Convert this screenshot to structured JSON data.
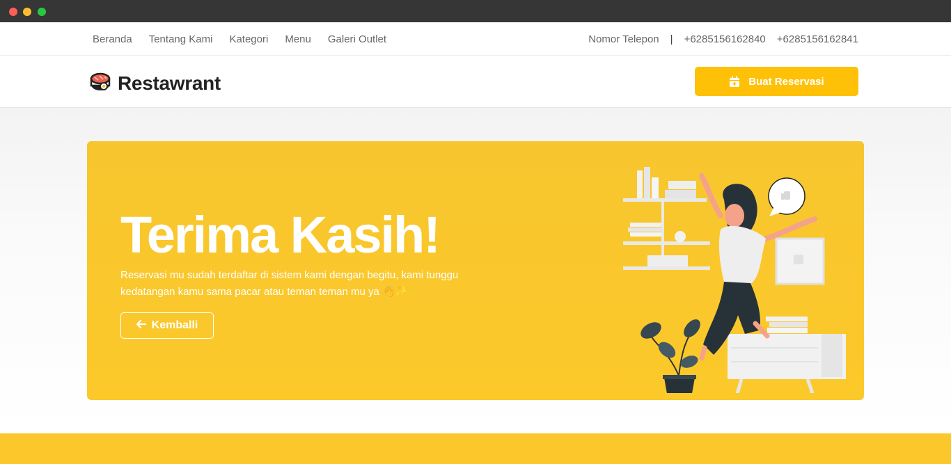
{
  "window": {
    "controls": [
      "close",
      "minimize",
      "maximize"
    ]
  },
  "topbar": {
    "nav": [
      "Beranda",
      "Tentang Kami",
      "Kategori",
      "Menu",
      "Galeri Outlet"
    ],
    "contact_label": "Nomor Telepon",
    "separator": "|",
    "phones": [
      "+6285156162840",
      "+6285156162841"
    ]
  },
  "header": {
    "brand": "Restawrant",
    "logo_icon": "sushi-icon",
    "reserve_button": "Buat Reservasi",
    "reserve_icon": "calendar-plus-icon"
  },
  "hero": {
    "title": "Terima Kasih!",
    "message_line1": "Reservasi mu sudah terdaftar di sistem kami dengan begitu, kami tunggu",
    "message_line2": "kedatangan kamu sama pacar atau teman teman mu ya 👋✨",
    "back_button": "Kemballi",
    "back_icon": "arrow-left-icon",
    "illustration": "jumping-woman-illustration"
  },
  "colors": {
    "accent": "#ffc107",
    "hero_bg": "#f9c72c",
    "titlebar": "#363636"
  }
}
